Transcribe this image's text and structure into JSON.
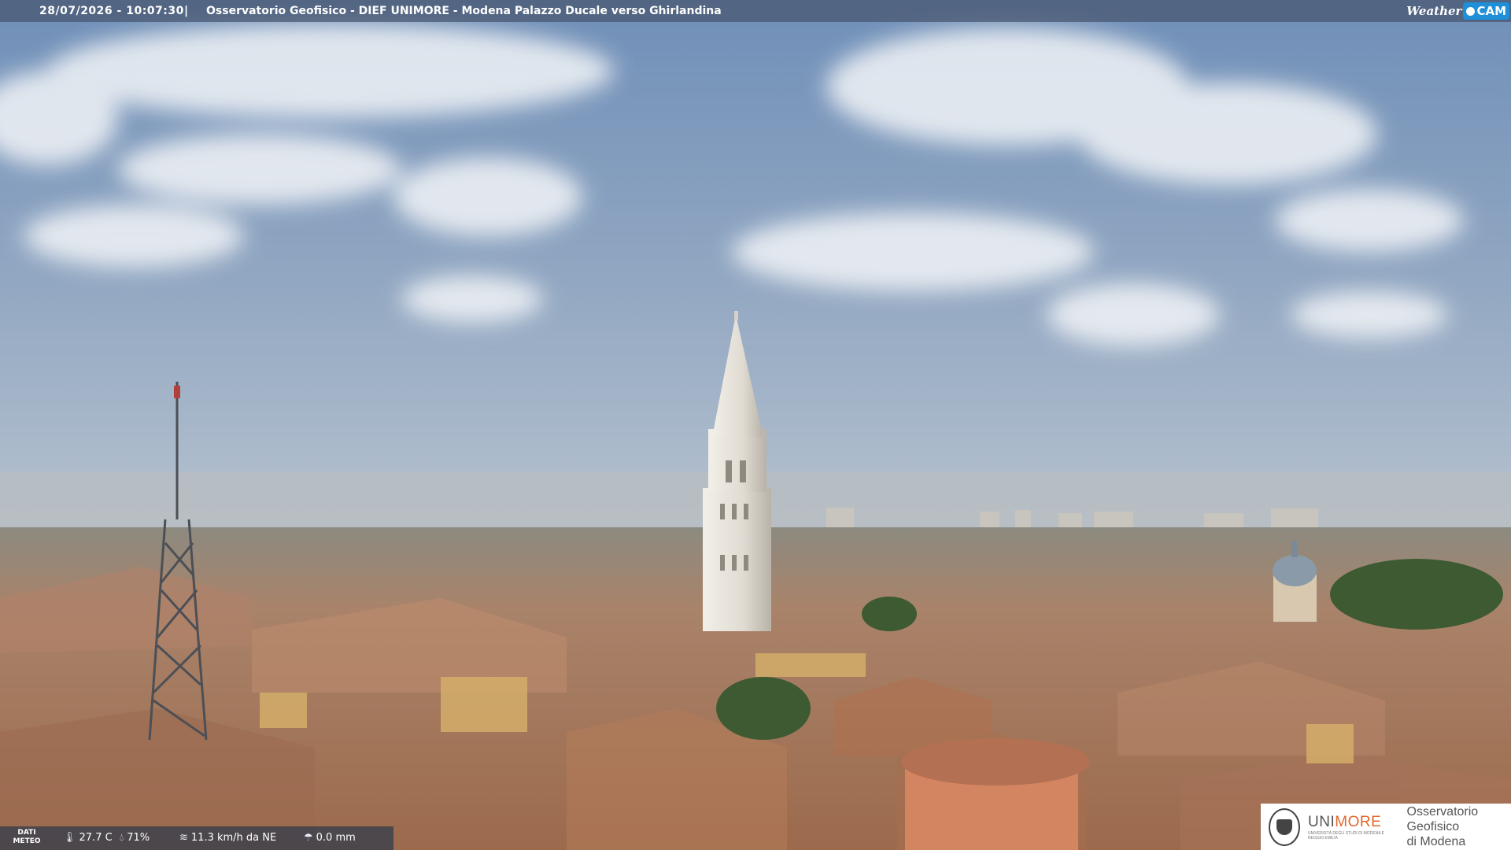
{
  "overlay": {
    "timestamp": "28/07/2026 - 10:07:30",
    "separator": "|",
    "title": "Osservatorio Geofisico - DIEF UNIMORE - Modena Palazzo Ducale verso Ghirlandina",
    "brand_weather": "Weather",
    "brand_cam": "CAM"
  },
  "meteo": {
    "label_line1": "DATI",
    "label_line2": "METEO",
    "temperature": "27.7 C",
    "humidity": "71%",
    "wind": "11.3 km/h da NE",
    "rain": "0.0 mm"
  },
  "logo": {
    "uni_prefix": "UNI",
    "uni_suffix": "MORE",
    "uni_sub": "UNIVERSITÀ DEGLI STUDI DI MODENA E REGGIO EMILIA",
    "obs_line1": "Osservatorio Geofisico",
    "obs_line2": "di Modena"
  },
  "colors": {
    "sky_top": "#6f8fb8",
    "sky_horizon": "#aebdd0",
    "roofs": "#b07a58",
    "tower": "#e4e0d8",
    "brand_cam": "#1f8fd8",
    "uni_accent": "#e2672a"
  },
  "icons": {
    "temperature": "thermometer-icon",
    "humidity": "humidity-drop-icon",
    "wind": "wind-icon",
    "rain": "rain-gauge-icon"
  }
}
